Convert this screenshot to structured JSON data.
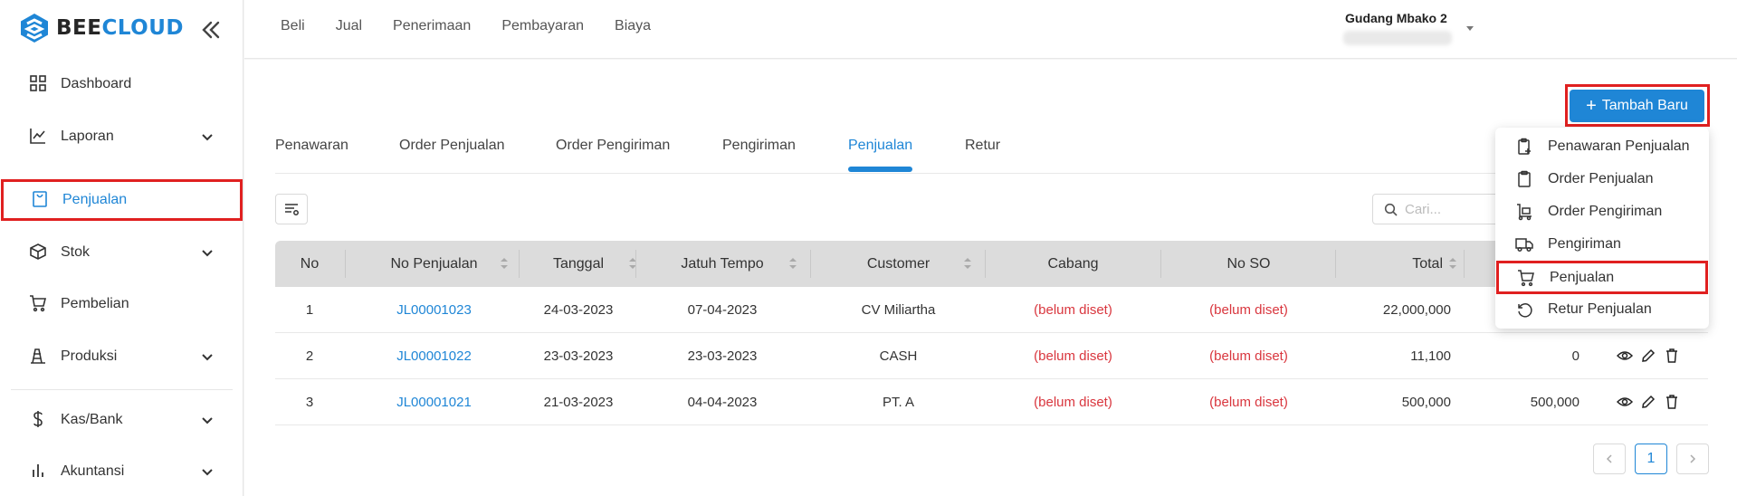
{
  "app": {
    "logo_part1": "BEE",
    "logo_part2": "CLOUD"
  },
  "sidebar": {
    "items": [
      {
        "label": "Dashboard",
        "icon": "dashboard-icon"
      },
      {
        "label": "Laporan",
        "icon": "chart-line-icon"
      },
      {
        "label": "Penjualan",
        "icon": "sales-bag-icon"
      },
      {
        "label": "Stok",
        "icon": "box-icon"
      },
      {
        "label": "Pembelian",
        "icon": "cart-icon"
      },
      {
        "label": "Produksi",
        "icon": "factory-icon"
      },
      {
        "label": "Kas/Bank",
        "icon": "dollar-icon"
      },
      {
        "label": "Akuntansi",
        "icon": "bar-chart-icon"
      }
    ]
  },
  "topnav": {
    "items": [
      "Beli",
      "Jual",
      "Penerimaan",
      "Pembayaran",
      "Biaya"
    ]
  },
  "user": {
    "name": "Gudang Mbako 2"
  },
  "add_button": {
    "label": "Tambah Baru"
  },
  "tabs": [
    "Penawaran",
    "Order Penjualan",
    "Order Pengiriman",
    "Pengiriman",
    "Penjualan",
    "Retur"
  ],
  "search": {
    "placeholder": "Cari..."
  },
  "table": {
    "headers": [
      "No",
      "No Penjualan",
      "Tanggal",
      "Jatuh Tempo",
      "Customer",
      "Cabang",
      "No SO",
      "Total"
    ],
    "rows": [
      {
        "no": "1",
        "no_penjualan": "JL00001023",
        "tanggal": "24-03-2023",
        "jatuh_tempo": "07-04-2023",
        "customer": "CV Miliartha",
        "cabang": "(belum diset)",
        "no_so": "(belum diset)",
        "total": "22,000,000",
        "sisa": ""
      },
      {
        "no": "2",
        "no_penjualan": "JL00001022",
        "tanggal": "23-03-2023",
        "jatuh_tempo": "23-03-2023",
        "customer": "CASH",
        "cabang": "(belum diset)",
        "no_so": "(belum diset)",
        "total": "11,100",
        "sisa": "0"
      },
      {
        "no": "3",
        "no_penjualan": "JL00001021",
        "tanggal": "21-03-2023",
        "jatuh_tempo": "04-04-2023",
        "customer": "PT. A",
        "cabang": "(belum diset)",
        "no_so": "(belum diset)",
        "total": "500,000",
        "sisa": "500,000"
      }
    ]
  },
  "pagination": {
    "current": "1"
  },
  "dropdown": {
    "items": [
      {
        "label": "Penawaran Penjualan",
        "icon": "clipboard-plus-icon"
      },
      {
        "label": "Order Penjualan",
        "icon": "clipboard-icon"
      },
      {
        "label": "Order Pengiriman",
        "icon": "trolley-icon"
      },
      {
        "label": "Pengiriman",
        "icon": "truck-icon"
      },
      {
        "label": "Penjualan",
        "icon": "cart-icon"
      },
      {
        "label": "Retur Penjualan",
        "icon": "undo-icon"
      }
    ]
  },
  "colors": {
    "accent": "#1f86d6",
    "highlight": "#e02020",
    "unset": "#d9363e"
  }
}
